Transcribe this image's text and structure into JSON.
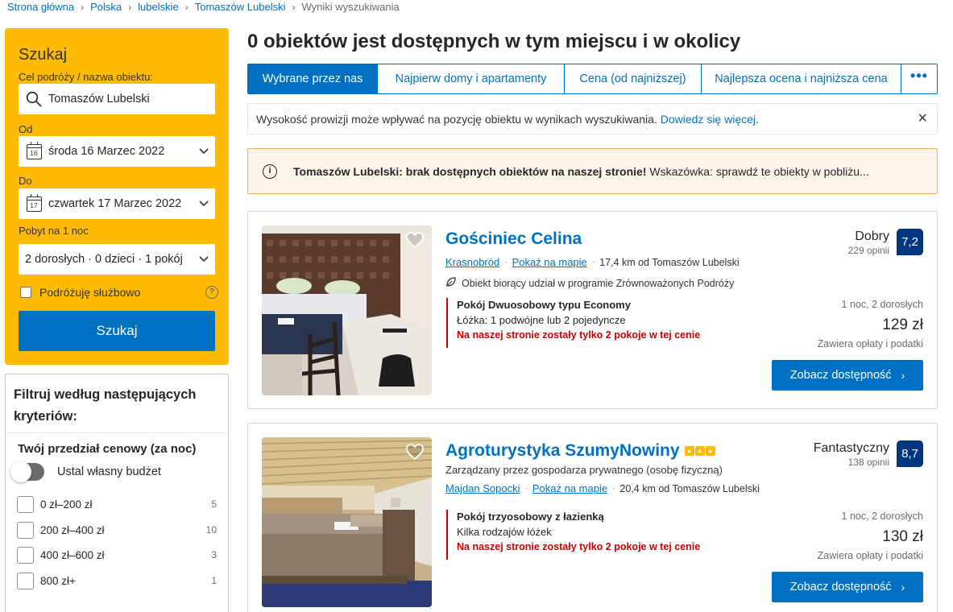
{
  "breadcrumb": [
    {
      "label": "Strona główna"
    },
    {
      "label": "Polska"
    },
    {
      "label": "lubelskie"
    },
    {
      "label": "Tomaszów Lubelski"
    },
    {
      "label": "Wyniki wyszukiwania"
    }
  ],
  "search": {
    "title": "Szukaj",
    "destination_label": "Cel podróży / nazwa obiektu:",
    "destination_value": "Tomaszów Lubelski",
    "checkin_label": "Od",
    "checkin_day": "16",
    "checkin_value": "środa 16 Marzec 2022",
    "checkout_label": "Do",
    "checkout_day": "17",
    "checkout_value": "czwartek 17 Marzec 2022",
    "stay_label": "Pobyt na 1 noc",
    "guests_value": "2 dorosłych · 0 dzieci · 1 pokój",
    "business_label": "Podróżuję służbowo",
    "help_glyph": "?",
    "button_label": "Szukaj"
  },
  "filters": {
    "title": "Filtruj według następujących kryteriów:",
    "price_title": "Twój przedział cenowy (za noc)",
    "budget_toggle_label": "Ustal własny budżet",
    "price_ranges": [
      {
        "label": "0 zł–200 zł",
        "count": "5"
      },
      {
        "label": "200 zł–400 zł",
        "count": "10"
      },
      {
        "label": "400 zł–600 zł",
        "count": "3"
      },
      {
        "label": "800 zł+",
        "count": "1"
      }
    ]
  },
  "main": {
    "heading": "0 obiektów jest dostępnych w tym miejscu i w okolicy",
    "tabs": [
      {
        "label": "Wybrane przez nas"
      },
      {
        "label": "Najpierw domy i apartamenty"
      },
      {
        "label": "Cena (od najniższej)"
      },
      {
        "label": "Najlepsza ocena i najniższa cena"
      },
      {
        "label": "•••"
      }
    ],
    "notice_text": "Wysokość prowizji może wpływać na pozycję obiektu w wynikach wyszukiwania.",
    "notice_link": "Dowiedz się więcej",
    "notice_dot": ".",
    "notice_close": "×",
    "alert_icon": "i",
    "alert_bold": "Tomaszów Lubelski: brak dostępnych obiektów na naszej stronie!",
    "alert_text": "Wskazówka: sprawdź te obiekty w pobliżu..."
  },
  "properties": [
    {
      "name": "Gościniec Celina",
      "stars": 0,
      "managed": "",
      "location": "Krasnobród",
      "map_link": "Pokaż na mapie",
      "distance": "17,4 km od Tomaszów Lubelski",
      "eco_text": "Obiekt biorący udział w programie Zrównoważonych Podróży",
      "room_type": "Pokój Dwuosobowy typu Economy",
      "beds": "Łóżka: 1 podwójne lub 2 pojedyncze",
      "scarcity": "Na naszej stronie zostały tylko 2 pokoje w tej cenie",
      "rating_word": "Dobry",
      "reviews": "229 opinii",
      "score": "7,2",
      "stay": "1 noc, 2 dorosłych",
      "price": "129 zł",
      "taxes": "Zawiera opłaty i podatki",
      "button": "Zobacz dostępność",
      "button_arrow": "›"
    },
    {
      "name": "Agroturystyka SzumyNowiny",
      "stars": 3,
      "managed": "Zarządzany przez gospodarza prywatnego (osobę fizyczną)",
      "location": "Majdan Sopocki",
      "map_link": "Pokaż na mapie",
      "distance": "20,4 km od Tomaszów Lubelski",
      "eco_text": "",
      "room_type": "Pokój trzyosobowy z łazienką",
      "beds": "Kilka rodzajów łóżek",
      "scarcity": "Na naszej stronie zostały tylko 2 pokoje w tej cenie",
      "rating_word": "Fantastyczny",
      "reviews": "138 opinii",
      "score": "8,7",
      "stay": "1 noc, 2 dorosłych",
      "price": "130 zł",
      "taxes": "Zawiera opłaty i podatki",
      "button": "Zobacz dostępność",
      "button_arrow": "›"
    }
  ],
  "colors": {
    "brand_blue": "#0071c2",
    "search_yellow": "#febb02",
    "score_blue": "#003580",
    "alert_orange": "#f1ad54",
    "scarcity_red": "#cc0000"
  }
}
